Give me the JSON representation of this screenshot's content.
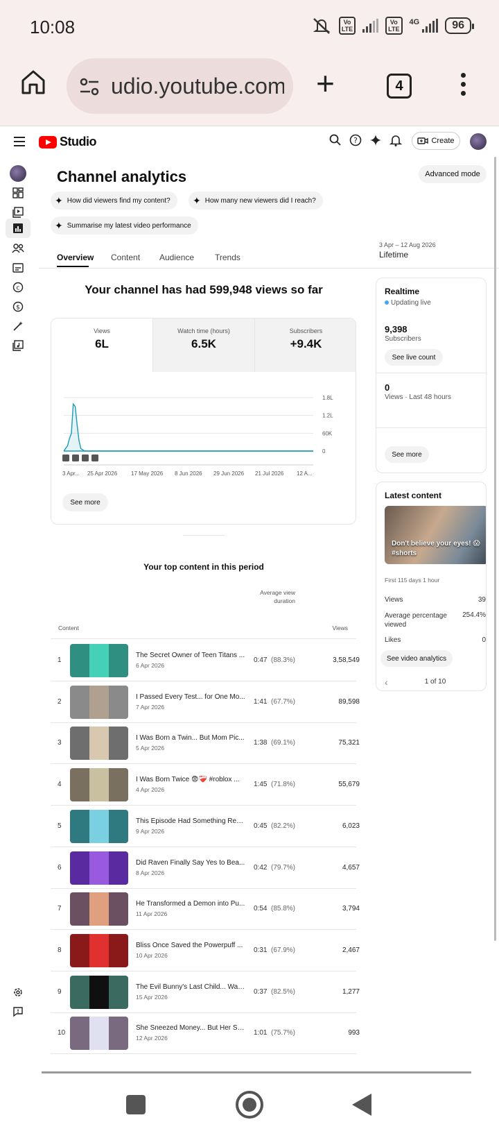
{
  "status_bar": {
    "time": "10:08",
    "network": "4G",
    "battery": "96",
    "volte": "Vo LTE"
  },
  "browser": {
    "url": "udio.youtube.com",
    "tab_count": "4"
  },
  "header": {
    "studio_label": "Studio",
    "create_label": "Create"
  },
  "page": {
    "title": "Channel analytics",
    "advanced_mode": "Advanced mode",
    "chips": [
      "How did viewers find my content?",
      "How many new viewers did I reach?",
      "Summarise my latest video performance"
    ],
    "tabs": [
      "Overview",
      "Content",
      "Audience",
      "Trends"
    ],
    "active_tab": "Overview",
    "date_range": "3 Apr – 12 Aug 2026",
    "range_label": "Lifetime",
    "headline": "Your channel has had 599,948 views so far"
  },
  "metrics": [
    {
      "label": "Views",
      "value": "6L"
    },
    {
      "label": "Watch time (hours)",
      "value": "6.5K"
    },
    {
      "label": "Subscribers",
      "value": "+9.4K"
    }
  ],
  "chart_data": {
    "type": "line",
    "title": "",
    "xlabel": "",
    "ylabel": "",
    "x_ticks": [
      "3 Apr...",
      "25 Apr 2026",
      "17 May 2026",
      "8 Jun 2026",
      "29 Jun 2026",
      "21 Jul 2026",
      "12 A..."
    ],
    "y_ticks": [
      "0",
      "60K",
      "1.2L",
      "1.8L"
    ],
    "y_tick_values": [
      0,
      60000,
      120000,
      180000
    ],
    "series": [
      {
        "x": [
          "2026-04-03",
          "2026-04-05",
          "2026-04-06",
          "2026-04-07",
          "2026-04-08",
          "2026-04-09",
          "2026-04-10",
          "2026-04-11",
          "2026-04-12",
          "2026-04-14",
          "2026-08-12"
        ],
        "values": [
          0,
          18000,
          42000,
          60000,
          158000,
          150000,
          90000,
          35000,
          8000,
          0,
          0
        ]
      }
    ],
    "ylim": [
      0,
      180000
    ],
    "grid": true,
    "line_color": "#1a9bb8",
    "markers_count": 4
  },
  "see_more": "See more",
  "top_content": {
    "title": "Your top content in this period",
    "col_content": "Content",
    "col_avg": "Average view duration",
    "col_views": "Views",
    "rows": [
      {
        "rank": "1",
        "title": "The Secret Owner of Teen Titans ...",
        "date": "6 Apr 2026",
        "duration": "0:47",
        "pct": "(88.3%)",
        "views": "3,58,549",
        "c1": "#2f8f80",
        "c2": "#45d0b8"
      },
      {
        "rank": "2",
        "title": "I Passed Every Test... for One Mo...",
        "date": "7 Apr 2026",
        "duration": "1:41",
        "pct": "(67.7%)",
        "views": "89,598",
        "c1": "#8a8a8a",
        "c2": "#b0a090"
      },
      {
        "rank": "3",
        "title": "I Was Born a Twin... But Mom Pic...",
        "date": "5 Apr 2026",
        "duration": "1:38",
        "pct": "(69.1%)",
        "views": "75,321",
        "c1": "#6e6e6e",
        "c2": "#d8c8b0"
      },
      {
        "rank": "4",
        "title": "I Was Born Twice 😨❤️‍🩹 #roblox ...",
        "date": "4 Apr 2026",
        "duration": "1:45",
        "pct": "(71.8%)",
        "views": "55,679",
        "c1": "#7a7060",
        "c2": "#c8c0a0"
      },
      {
        "rank": "5",
        "title": "This Episode Had Something Rea...",
        "date": "9 Apr 2026",
        "duration": "0:45",
        "pct": "(82.2%)",
        "views": "6,023",
        "c1": "#2e7a80",
        "c2": "#7ad0e0"
      },
      {
        "rank": "6",
        "title": "Did Raven Finally Say Yes to Bea...",
        "date": "8 Apr 2026",
        "duration": "0:42",
        "pct": "(79.7%)",
        "views": "4,657",
        "c1": "#5a2aa0",
        "c2": "#9a5ae0"
      },
      {
        "rank": "7",
        "title": "He Transformed a Demon into Pu...",
        "date": "11 Apr 2026",
        "duration": "0:54",
        "pct": "(85.8%)",
        "views": "3,794",
        "c1": "#6a5060",
        "c2": "#e0a080"
      },
      {
        "rank": "8",
        "title": "Bliss Once Saved the Powerpuff ...",
        "date": "10 Apr 2026",
        "duration": "0:31",
        "pct": "(67.9%)",
        "views": "2,467",
        "c1": "#8a1a1a",
        "c2": "#e03030"
      },
      {
        "rank": "9",
        "title": "The Evil Bunny's Last Child... Was...",
        "date": "15 Apr 2026",
        "duration": "0:37",
        "pct": "(82.5%)",
        "views": "1,277",
        "c1": "#3a6a60",
        "c2": "#101010"
      },
      {
        "rank": "10",
        "title": "She Sneezed Money... But Her Sis...",
        "date": "12 Apr 2026",
        "duration": "1:01",
        "pct": "(75.7%)",
        "views": "993",
        "c1": "#7a6a80",
        "c2": "#e0e0f0"
      }
    ]
  },
  "realtime": {
    "title": "Realtime",
    "updating": "Updating live",
    "subscribers_value": "9,398",
    "subscribers_label": "Subscribers",
    "see_live": "See live count",
    "views_value": "0",
    "views_label": "Views · Last 48 hours",
    "see_more": "See more"
  },
  "latest": {
    "title": "Latest content",
    "caption": "Don't believe your eyes! 😱 #shorts",
    "first": "First 115 days 1 hour",
    "stats": [
      {
        "label": "Views",
        "value": "39"
      },
      {
        "label": "Average percentage viewed",
        "value": "254.4%"
      },
      {
        "label": "Likes",
        "value": "0"
      }
    ],
    "see_analytics": "See video analytics",
    "pager": "1 of 10"
  }
}
